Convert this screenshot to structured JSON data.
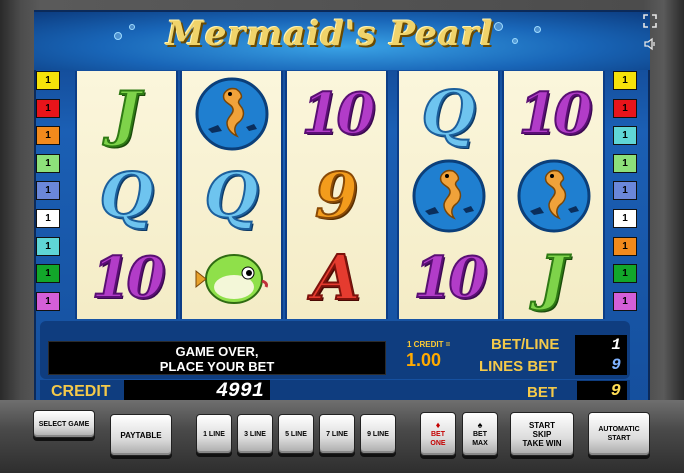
{
  "game": {
    "title": "Mermaid's Pearl",
    "fullscreen_icon": "fullscreen-icon",
    "sound_icon": "speaker-icon"
  },
  "line_markers": {
    "left": [
      {
        "label": "1",
        "color": "#f6e20a"
      },
      {
        "label": "1",
        "color": "#e8141a"
      },
      {
        "label": "1",
        "color": "#f28a1c"
      },
      {
        "label": "1",
        "color": "#8de07a"
      },
      {
        "label": "1",
        "color": "#6b87d9"
      },
      {
        "label": "1",
        "color": "#ffffff"
      },
      {
        "label": "1",
        "color": "#5fd6d6"
      },
      {
        "label": "1",
        "color": "#12a62a"
      },
      {
        "label": "1",
        "color": "#d45fd8"
      }
    ],
    "right": [
      {
        "label": "1",
        "color": "#f6e20a"
      },
      {
        "label": "1",
        "color": "#e8141a"
      },
      {
        "label": "1",
        "color": "#5fd6d6"
      },
      {
        "label": "1",
        "color": "#8de07a"
      },
      {
        "label": "1",
        "color": "#6b87d9"
      },
      {
        "label": "1",
        "color": "#ffffff"
      },
      {
        "label": "1",
        "color": "#f28a1c"
      },
      {
        "label": "1",
        "color": "#12a62a"
      },
      {
        "label": "1",
        "color": "#d45fd8"
      }
    ]
  },
  "reels": [
    [
      "J",
      "Q",
      "10"
    ],
    [
      "seahorse",
      "Q",
      "pufferfish"
    ],
    [
      "10",
      "9",
      "A"
    ],
    [
      "Q",
      "seahorse",
      "10"
    ],
    [
      "10",
      "seahorse",
      "J"
    ]
  ],
  "info": {
    "message_line1": "GAME OVER,",
    "message_line2": "PLACE YOUR BET",
    "credit_rate_label": "1 CREDIT =",
    "credit_rate_value": "1.00",
    "bet_line_label": "BET/LINE",
    "bet_line_value": "1",
    "lines_bet_label": "LINES BET",
    "lines_bet_value": "9",
    "credit_label": "CREDIT",
    "credit_value": "4991",
    "bet_label": "BET",
    "bet_value": "9"
  },
  "buttons": {
    "select_game": "SELECT GAME",
    "paytable": "PAYTABLE",
    "line1": "1 LINE",
    "line3": "3 LINE",
    "line5": "5 LINE",
    "line7": "7 LINE",
    "line9": "9 LINE",
    "bet_one": "BET ONE",
    "bet_max": "BET MAX",
    "start": "START",
    "skip": "SKIP",
    "take_win": "TAKE WIN",
    "automatic_start": "AUTOMATIC START"
  }
}
